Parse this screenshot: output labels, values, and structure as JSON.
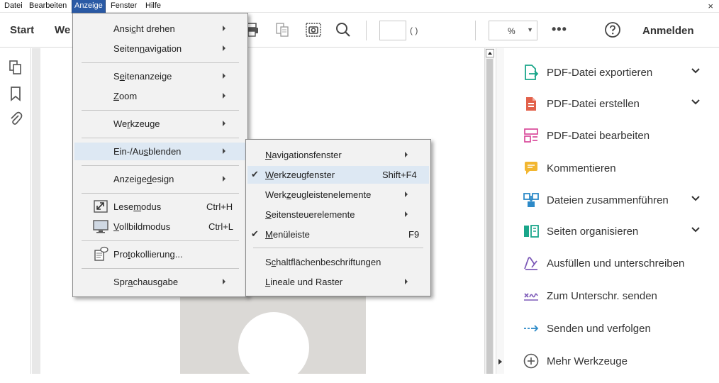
{
  "menubar": {
    "items": [
      "Datei",
      "Bearbeiten",
      "Anzeige",
      "Fenster",
      "Hilfe"
    ],
    "active": "Anzeige",
    "close": "×"
  },
  "toolbar": {
    "tabs": [
      "Start",
      "We"
    ],
    "page_count": "(                )",
    "zoom_value": "%",
    "zoom_caret": "▼",
    "more": "•••",
    "signin": "Anmelden"
  },
  "anzeige_menu": {
    "items": [
      {
        "label_pre": "Ansi",
        "label_u": "c",
        "label_post": "ht drehen",
        "submenu": true
      },
      {
        "label_pre": "Seiten",
        "label_u": "n",
        "label_post": "avigation",
        "submenu": true
      },
      {
        "label_pre": "S",
        "label_u": "e",
        "label_post": "itenanzeige",
        "submenu": true
      },
      {
        "label_pre": "",
        "label_u": "Z",
        "label_post": "oom",
        "submenu": true
      },
      {
        "label_pre": "We",
        "label_u": "r",
        "label_post": "kzeuge",
        "submenu": true
      },
      {
        "label_pre": "Ein-/Au",
        "label_u": "s",
        "label_post": "blenden",
        "submenu": true
      },
      {
        "label_pre": "Anzeige",
        "label_u": "d",
        "label_post": "esign",
        "submenu": true
      },
      {
        "label_pre": "Lese",
        "label_u": "m",
        "label_post": "odus",
        "shortcut": "Ctrl+H"
      },
      {
        "label_pre": "",
        "label_u": "V",
        "label_post": "ollbildmodus",
        "shortcut": "Ctrl+L"
      },
      {
        "label_pre": "Pro",
        "label_u": "t",
        "label_post": "okollierung...",
        "submenu": false
      },
      {
        "label_pre": "Spr",
        "label_u": "a",
        "label_post": "chausgabe",
        "submenu": true
      }
    ]
  },
  "einblenden_menu": {
    "items": [
      {
        "label_pre": "",
        "label_u": "N",
        "label_post": "avigationsfenster",
        "submenu": true,
        "checked": false
      },
      {
        "label_pre": "",
        "label_u": "W",
        "label_post": "erkzeugfenster",
        "shortcut": "Shift+F4",
        "checked": true
      },
      {
        "label_pre": "Werk",
        "label_u": "z",
        "label_post": "eugleistenelemente",
        "submenu": true,
        "checked": false
      },
      {
        "label_pre": "",
        "label_u": "S",
        "label_post": "eitensteuerelemente",
        "submenu": true,
        "checked": false
      },
      {
        "label_pre": "",
        "label_u": "M",
        "label_post": "enüleiste",
        "shortcut": "F9",
        "checked": true
      },
      {
        "label_pre": "S",
        "label_u": "c",
        "label_post": "haltflächenbeschriftungen",
        "submenu": false,
        "checked": false
      },
      {
        "label_pre": "",
        "label_u": "L",
        "label_post": "ineale und Raster",
        "submenu": true,
        "checked": false
      }
    ]
  },
  "tools": [
    {
      "label": "PDF-Datei exportieren",
      "icon": "export-pdf-icon",
      "expand": true,
      "color": "#1aa68a"
    },
    {
      "label": "PDF-Datei erstellen",
      "icon": "create-pdf-icon",
      "expand": true,
      "color": "#e2614b"
    },
    {
      "label": "PDF-Datei bearbeiten",
      "icon": "edit-pdf-icon",
      "expand": false,
      "color": "#d9499a"
    },
    {
      "label": "Kommentieren",
      "icon": "comment-icon",
      "expand": false,
      "color": "#f2b630"
    },
    {
      "label": "Dateien zusammenführen",
      "icon": "combine-files-icon",
      "expand": true,
      "color": "#2d8ac8"
    },
    {
      "label": "Seiten organisieren",
      "icon": "organize-pages-icon",
      "expand": true,
      "color": "#1aa68a"
    },
    {
      "label": "Ausfüllen und unterschreiben",
      "icon": "fill-sign-icon",
      "expand": false,
      "color": "#7d5ab8"
    },
    {
      "label": "Zum Unterschr. senden",
      "icon": "send-for-signature-icon",
      "expand": false,
      "color": "#7d5ab8"
    },
    {
      "label": "Senden und verfolgen",
      "icon": "send-track-icon",
      "expand": false,
      "color": "#2d8ac8"
    },
    {
      "label": "Mehr Werkzeuge",
      "icon": "more-tools-icon",
      "expand": false,
      "color": "#555555"
    }
  ]
}
